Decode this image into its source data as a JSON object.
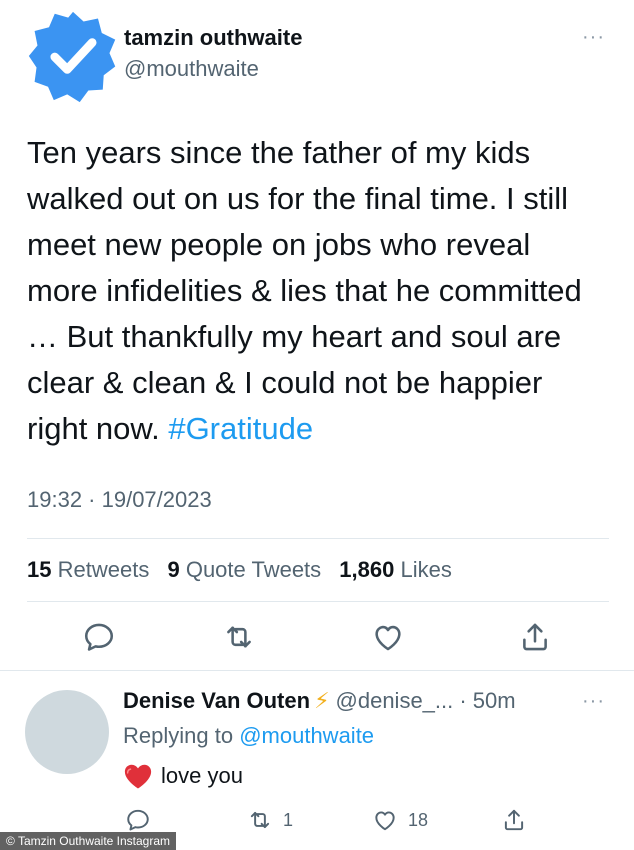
{
  "author": {
    "name": "tamzin outhwaite",
    "handle": "@mouthwaite"
  },
  "tweet": {
    "text": "Ten years since the father of my kids walked out on us for the final time. I still meet new people on jobs who reveal more infidelities & lies that he committed … But thankfully my heart and soul are clear & clean & I could not be happier right now.",
    "hashtag": "#Gratitude",
    "timestamp": "19:32 · 19/07/2023"
  },
  "stats": {
    "retweets_count": "15",
    "retweets_label": "Retweets",
    "quotes_count": "9",
    "quotes_label": "Quote Tweets",
    "likes_count": "1,860",
    "likes_label": "Likes"
  },
  "more_label": "···",
  "reply": {
    "name": "Denise Van Outen",
    "badge_glyph": "⚡",
    "meta": "@denise_... · 50m",
    "replying_prefix": "Replying to",
    "replying_mention": "@mouthwaite",
    "text": "love you",
    "retweet_count": "1",
    "like_count": "18"
  },
  "credit": "© Tamzin Outhwaite Instagram",
  "colors": {
    "accent": "#1d9bf0",
    "verified": "#3b94f2"
  },
  "icons": [
    "verified-badge-icon",
    "more-icon",
    "reply-icon",
    "retweet-icon",
    "like-icon",
    "share-icon",
    "red-heart-icon"
  ]
}
